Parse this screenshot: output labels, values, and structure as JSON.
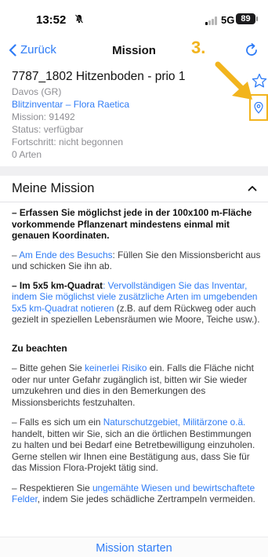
{
  "status": {
    "time": "13:52",
    "network": "5G",
    "battery": "89"
  },
  "nav": {
    "back_label": "Zurück",
    "title": "Mission"
  },
  "annotation": {
    "number": "3.",
    "color": "#f2b41d"
  },
  "mission": {
    "title": "7787_1802 Hitzenboden - prio 1",
    "location": "Davos (GR)",
    "project": "Blitzinventar – Flora Raetica",
    "mission_id": "Mission: 91492",
    "status": "Status: verfügbar",
    "progress": "Fortschritt: nicht begonnen",
    "species": "0 Arten"
  },
  "section": {
    "title": "Meine Mission"
  },
  "content": {
    "item1": "– Erfassen Sie möglichst jede in der 100x100 m-Fläche vorkommende Pflanzenart mindestens einmal mit genauen Koordinaten.",
    "item2_prefix": "– ",
    "item2_link": "Am Ende des Besuchs",
    "item2_rest": ": Füllen Sie den Missionsbericht aus und schicken Sie ihn ab.",
    "item3_prefix": "– ",
    "item3_bold": "Im 5x5 km-Quadrat",
    "item3_colon": ": ",
    "item3_link": "Vervollständigen Sie das Inventar, indem Sie möglichst viele zusätzliche Arten im umgebenden 5x5 km-Quadrat notieren",
    "item3_rest": " (z.B. auf dem Rückweg oder auch gezielt in speziellen Lebensräumen wie Moore, Teiche usw.).",
    "subheading": "Zu beachten",
    "note1_pre": "– Bitte gehen Sie ",
    "note1_link": "keinerlei Risiko",
    "note1_rest": " ein. Falls die Fläche nicht oder nur unter Gefahr zugänglich ist, bitten wir Sie wieder umzukehren und dies in den Bemerkungen des Missionsberichts festzuhalten.",
    "note2_pre": "– Falls es sich um ein ",
    "note2_link": "Naturschutzgebiet, Militärzone o.ä.",
    "note2_rest": " handelt, bitten wir Sie, sich an die örtlichen Bestimmungen zu halten und bei Bedarf eine Betretbewilligung einzuholen. Gerne stellen wir Ihnen eine Bestätigung aus, dass Sie für das Mission Flora-Projekt tätig sind.",
    "note3_pre": "– Respektieren Sie ",
    "note3_link": "ungemähte Wiesen und bewirtschaftete Felder",
    "note3_rest": ", indem Sie jedes schädliche Zertrampeln vermeiden."
  },
  "footer": {
    "start_label": "Mission starten"
  },
  "icons": {
    "back": "chevron-left-icon",
    "refresh": "refresh-icon",
    "favorite": "star-icon",
    "location": "map-pin-icon",
    "collapse": "chevron-up-icon",
    "dnd": "bell-slash-icon"
  }
}
